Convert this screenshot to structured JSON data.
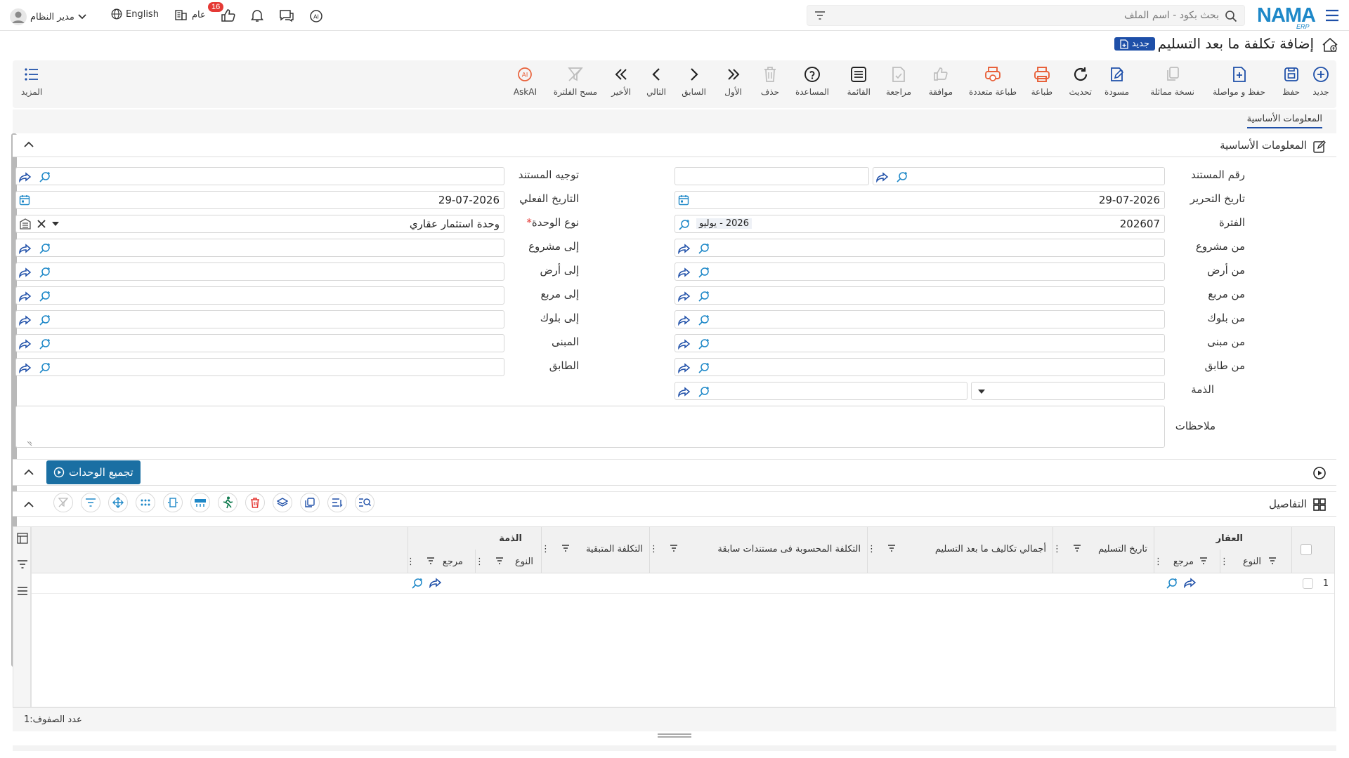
{
  "app": {
    "logo_text": "NAMA",
    "logo_sub": "ERP"
  },
  "topbar": {
    "search_placeholder": "بحث بكود - اسم الملف",
    "user_name": "مدير النظام",
    "language": "English",
    "scope": "عام",
    "notification_count": "16"
  },
  "page": {
    "title": "إضافة تكلفة ما بعد التسليم",
    "new_tag": "جديد"
  },
  "toolbar": {
    "new": "جديد",
    "save": "حفظ",
    "save_continue": "حفظ و مواصلة",
    "duplicate": "نسخة مماثلة",
    "draft": "مسودة",
    "refresh": "تحديث",
    "print": "طباعة",
    "multi_print": "طباعة متعددة",
    "approve": "موافقة",
    "review": "مراجعة",
    "list": "القائمة",
    "help": "المساعدة",
    "delete": "حذف",
    "first": "الأول",
    "prev": "السابق",
    "next": "التالي",
    "last": "الأخير",
    "clear_filter": "مسح الفلترة",
    "askai": "AskAI",
    "more": "المزيد"
  },
  "tabs": {
    "basic": "المعلومات الأساسية"
  },
  "section_basic": {
    "title": "المعلومات الأساسية"
  },
  "form": {
    "doc_number_label": "رقم المستند",
    "doc_direction_label": "توجيه المستند",
    "edit_date_label": "تاريخ التحرير",
    "edit_date": "29-07-2026",
    "actual_date_label": "التاريخ الفعلي",
    "actual_date": "29-07-2026",
    "period_label": "الفترة",
    "period_code": "202607",
    "period_name": "2026 - يوليو",
    "unit_type_label": "نوع الوحدة",
    "unit_type": "وحدة استثمار عقاري",
    "from_project_label": "من مشروع",
    "to_project_label": "إلى مشروع",
    "from_land_label": "من أرض",
    "to_land_label": "إلى أرض",
    "from_square_label": "من مربع",
    "to_square_label": "إلى مربع",
    "from_block_label": "من بلوك",
    "to_block_label": "إلى بلوك",
    "from_building_label": "من مبنى",
    "building_label": "المبنى",
    "from_floor_label": "من طابق",
    "floor_label": "الطابق",
    "account_label": "الذمة",
    "notes_label": "ملاحظات"
  },
  "group_units": {
    "label": "تجميع الوحدات"
  },
  "section_details": {
    "title": "التفاصيل"
  },
  "grid": {
    "group_property": "العقار",
    "group_account": "الذمة",
    "col_type": "النوع",
    "col_ref": "مرجع",
    "col_delivery_date": "تاريخ التسليم",
    "col_total_costs": "أجمالي تكاليف ما بعد التسليم",
    "col_prev_cost": "التكلفة المحسوبة فى مستندات سابقة",
    "col_remaining": "التكلفة المتبقية",
    "col_account_type": "النوع",
    "col_account_ref": "مرجع",
    "row1_num": "1",
    "row_count_label": "عدد الصفوف:",
    "row_count": "1"
  },
  "colors": {
    "primary": "#1e4fa8",
    "accent": "#1e88c8",
    "print": "#e8613a",
    "group_btn": "#1a6fa3"
  }
}
